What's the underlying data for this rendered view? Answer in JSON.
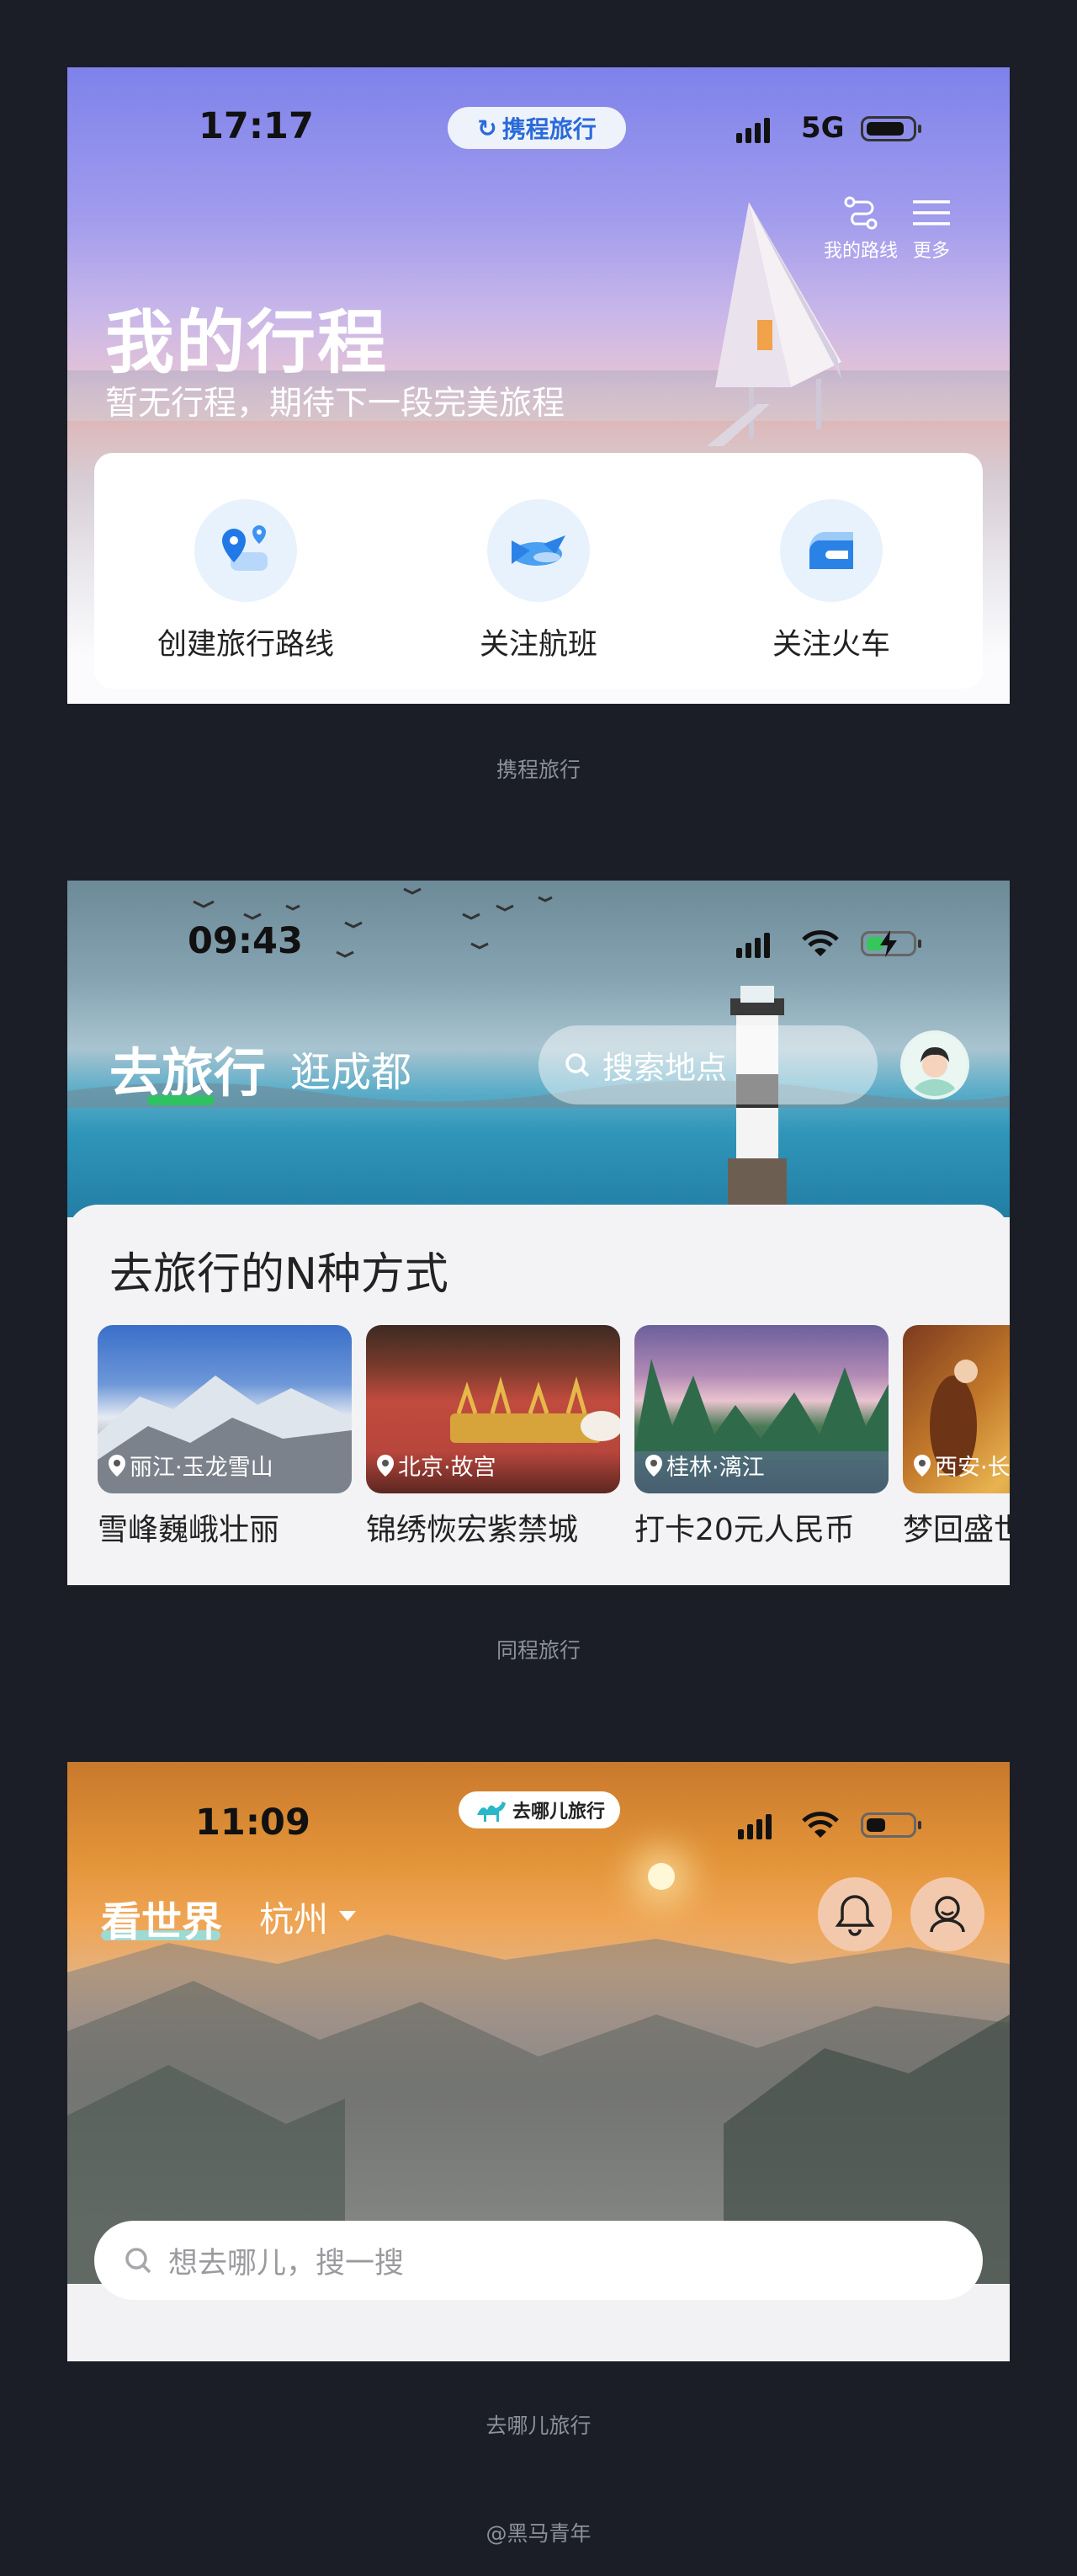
{
  "screens": [
    {
      "app": "携程旅行",
      "status": {
        "time": "17:17",
        "network": "5G"
      },
      "logo": "携程旅行",
      "top_actions": [
        {
          "label": "我的路线",
          "icon": "route-icon"
        },
        {
          "label": "更多",
          "icon": "menu-icon"
        }
      ],
      "title": "我的行程",
      "subtitle": "暂无行程，期待下一段完美旅程",
      "actions": [
        {
          "label": "创建旅行路线",
          "icon": "map-pin-route-icon"
        },
        {
          "label": "关注航班",
          "icon": "airplane-icon"
        },
        {
          "label": "关注火车",
          "icon": "train-icon"
        }
      ]
    },
    {
      "app": "同程旅行",
      "status": {
        "time": "09:43"
      },
      "tabs": [
        "去旅行",
        "逛成都"
      ],
      "search_placeholder": "搜索地点",
      "section_title": "去旅行的N种方式",
      "cards": [
        {
          "location": "丽江·玉龙雪山",
          "caption": "雪峰巍峨壮丽"
        },
        {
          "location": "北京·故宫",
          "caption": "锦绣恢宏紫禁城"
        },
        {
          "location": "桂林·漓江",
          "caption": "打卡20元人民币"
        },
        {
          "location": "西安·长",
          "caption": "梦回盛世"
        }
      ]
    },
    {
      "app": "去哪儿旅行",
      "status": {
        "time": "11:09"
      },
      "logo": "去哪儿旅行",
      "tab": "看世界",
      "city": "杭州",
      "search_placeholder": "想去哪儿，搜一搜"
    }
  ],
  "footer": "@黑马青年",
  "colors": {
    "page_bg": "#1b1e27",
    "ctrip_blue": "#2a6ad9",
    "tongcheng_green": "#2ec262",
    "qunar_teal": "#8fe3e9"
  }
}
